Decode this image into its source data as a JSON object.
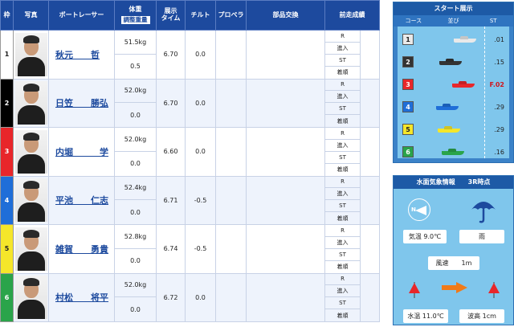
{
  "table": {
    "headers": {
      "waku": "枠",
      "photo": "写真",
      "racer": "ボートレーサー",
      "weight": "体重",
      "weight_adjust": "調整重量",
      "tenji_time": "展示\nタイム",
      "tilt": "チルト",
      "propeller": "プロペラ",
      "parts": "部品交換",
      "zensou": "前走成績"
    },
    "zensou_labels": [
      "R",
      "進入",
      "ST",
      "着順"
    ],
    "rows": [
      {
        "waku": "1",
        "name": "秋元　　哲",
        "weight": "51.5kg",
        "adjust": "0.5",
        "time": "6.70",
        "tilt": "0.0",
        "color": "#ffffff"
      },
      {
        "waku": "2",
        "name": "日笠　　勝弘",
        "weight": "52.0kg",
        "adjust": "0.0",
        "time": "6.70",
        "tilt": "0.0",
        "color": "#000000"
      },
      {
        "waku": "3",
        "name": "内堀　　　学",
        "weight": "52.0kg",
        "adjust": "0.0",
        "time": "6.60",
        "tilt": "0.0",
        "color": "#e8262a"
      },
      {
        "waku": "4",
        "name": "平池　　仁志",
        "weight": "52.4kg",
        "adjust": "0.0",
        "time": "6.71",
        "tilt": "-0.5",
        "color": "#1f6ed8"
      },
      {
        "waku": "5",
        "name": "雑賀　　勇貴",
        "weight": "52.8kg",
        "adjust": "0.0",
        "time": "6.74",
        "tilt": "-0.5",
        "color": "#f5e62a"
      },
      {
        "waku": "6",
        "name": "村松　　将平",
        "weight": "52.0kg",
        "adjust": "0.0",
        "time": "6.72",
        "tilt": "0.0",
        "color": "#2aa44a"
      }
    ]
  },
  "start": {
    "title": "スタート展示",
    "col_course": "コース",
    "col_order": "並び",
    "col_st": "ST",
    "lanes": [
      {
        "course": "1",
        "st": ".01",
        "color": "#e9e9e9",
        "text_color": "#222",
        "flying": false
      },
      {
        "course": "2",
        "st": ".15",
        "color": "#333333",
        "text_color": "#fff",
        "flying": false
      },
      {
        "course": "3",
        "st": "F.02",
        "color": "#e8262a",
        "text_color": "#fff",
        "flying": true
      },
      {
        "course": "4",
        "st": ".29",
        "color": "#1f6ed8",
        "text_color": "#fff",
        "flying": false
      },
      {
        "course": "5",
        "st": ".29",
        "color": "#f5e62a",
        "text_color": "#222",
        "flying": false
      },
      {
        "course": "6",
        "st": ".16",
        "color": "#2aa44a",
        "text_color": "#fff",
        "flying": false
      }
    ]
  },
  "weather": {
    "title": "水面気象情報　　3R時点",
    "compass_label": "N",
    "air_temp": "気温 9.0℃",
    "condition": "雨",
    "wind_speed": "風速　　1m",
    "water_temp": "水温 11.0℃",
    "wave_height": "波高 1cm"
  }
}
